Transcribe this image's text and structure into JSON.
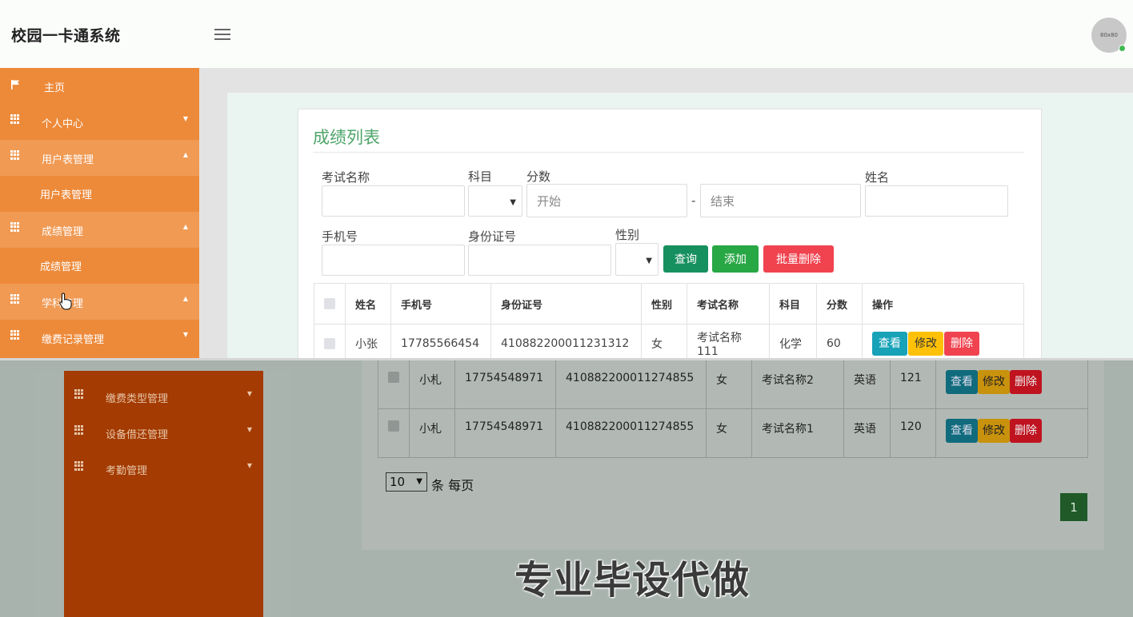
{
  "header": {
    "title": "校园一卡通系统",
    "avatar_text": "80x80"
  },
  "sidebar": {
    "items": [
      {
        "label": "主页",
        "icon": "flag-icon",
        "caret": ""
      },
      {
        "label": "个人中心",
        "icon": "grid-icon",
        "caret": "▼"
      },
      {
        "label": "用户表管理",
        "icon": "grid-icon",
        "caret": "▲"
      },
      {
        "label": "用户表管理",
        "sub": true
      },
      {
        "label": "成绩管理",
        "icon": "grid-icon",
        "caret": "▲"
      },
      {
        "label": "成绩管理",
        "sub": true
      },
      {
        "label": "学科管理",
        "icon": "grid-icon",
        "caret": "▲"
      },
      {
        "label": "缴费记录管理",
        "icon": "grid-icon",
        "caret": "▼"
      }
    ],
    "items_lower": [
      {
        "label": "缴费类型管理",
        "caret": "▼"
      },
      {
        "label": "设备借还管理",
        "caret": "▼"
      },
      {
        "label": "考勤管理",
        "caret": "▼"
      }
    ]
  },
  "panel": {
    "title": "成绩列表"
  },
  "filters": {
    "exam_name_label": "考试名称",
    "subject_label": "科目",
    "score_label": "分数",
    "score_start_placeholder": "开始",
    "score_sep": "-",
    "score_end_placeholder": "结束",
    "name_label": "姓名",
    "phone_label": "手机号",
    "id_label": "身份证号",
    "gender_label": "性别"
  },
  "buttons": {
    "query": "查询",
    "add": "添加",
    "batch_delete": "批量删除"
  },
  "colors": {
    "sidebar": "#ed8a3a",
    "title": "#4ea56a",
    "query": "#17905f",
    "add": "#28a745",
    "batch_delete": "#f0434f"
  },
  "table": {
    "headers": [
      "姓名",
      "手机号",
      "身份证号",
      "性别",
      "考试名称",
      "科目",
      "分数",
      "操作"
    ],
    "rows": [
      {
        "name": "小张",
        "phone": "17785566454",
        "id": "410882200011231312",
        "gender": "女",
        "exam": "考试名称111",
        "subject": "化学",
        "score": "60"
      },
      {
        "name": "小札",
        "phone": "17754548971",
        "id": "410882200011274855",
        "gender": "女",
        "exam": "考试名称2",
        "subject": "英语",
        "score": "121"
      },
      {
        "name": "小札",
        "phone": "17754548971",
        "id": "410882200011274855",
        "gender": "女",
        "exam": "考试名称1",
        "subject": "英语",
        "score": "120"
      }
    ],
    "actions": {
      "view": "查看",
      "edit": "修改",
      "delete": "删除"
    }
  },
  "pagination": {
    "per_page": "10",
    "per_page_suffix": "条 每页",
    "current_page": "1"
  },
  "watermark": "专业毕设代做"
}
